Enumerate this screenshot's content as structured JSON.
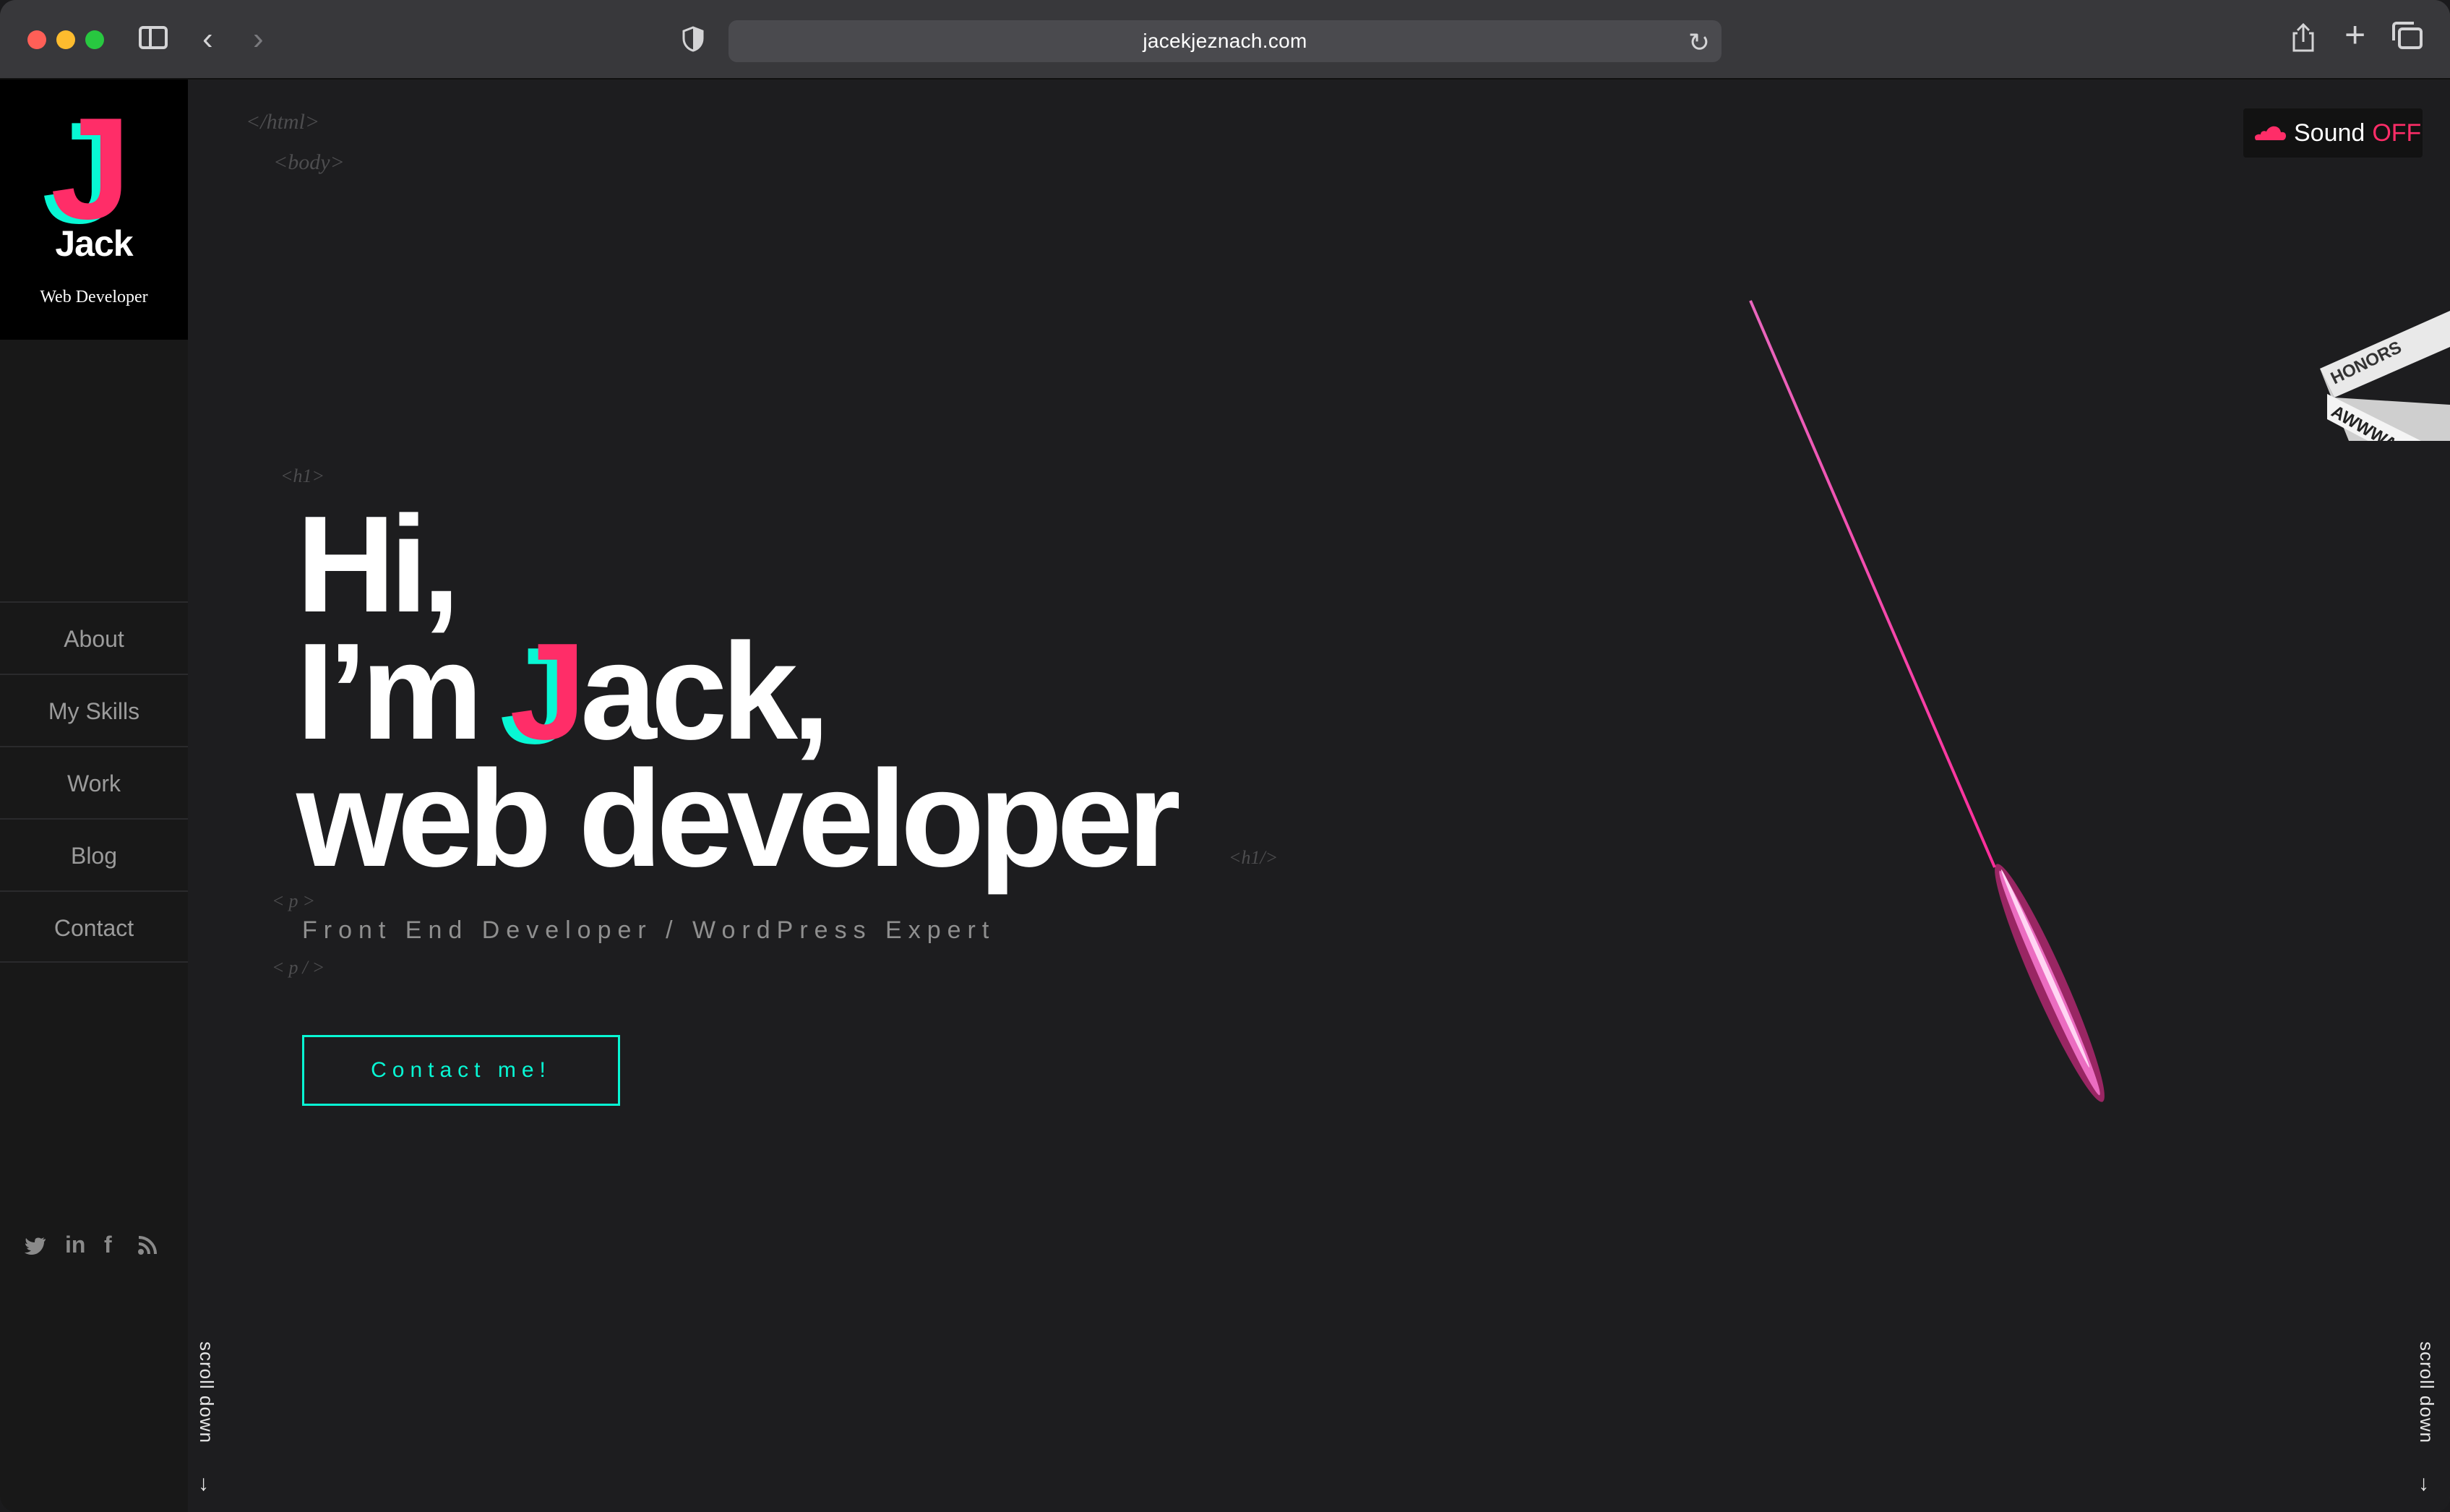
{
  "browser": {
    "url": "jacekjeznach.com"
  },
  "brand": {
    "logo_letter": "J",
    "name": "Jack",
    "subtitle": "Web Developer"
  },
  "nav": {
    "items": [
      {
        "label": "About"
      },
      {
        "label": "My Skills"
      },
      {
        "label": "Work"
      },
      {
        "label": "Blog"
      },
      {
        "label": "Contact"
      }
    ]
  },
  "social": {
    "icons": [
      "twitter-icon",
      "linkedin-icon",
      "facebook-icon",
      "rss-icon"
    ],
    "linkedin_text": "in",
    "facebook_text": "f"
  },
  "code_tags": {
    "html": "</html>",
    "body": "<body>",
    "h1_open": "<h1>",
    "h1_close": "<h1/>",
    "p_open": "<p>",
    "p_close": "<p/>"
  },
  "hero": {
    "line1": "Hi,",
    "line2_prefix": "I’m ",
    "line2_J": "J",
    "line2_suffix": "ack,",
    "line3": "web developer",
    "tagline": "Front End Developer / WordPress Expert",
    "cta_label": "Contact me!"
  },
  "sound": {
    "label": "Sound",
    "state": "OFF"
  },
  "awwwards": {
    "top_text": "HONORS",
    "bottom_text": "AWWWARDS"
  },
  "scroll": {
    "label": "scroll down",
    "arrow": "↓"
  },
  "colors": {
    "accent_pink": "#ff2d68",
    "accent_cyan": "#08f7d4",
    "background": "#1d1d1f"
  }
}
